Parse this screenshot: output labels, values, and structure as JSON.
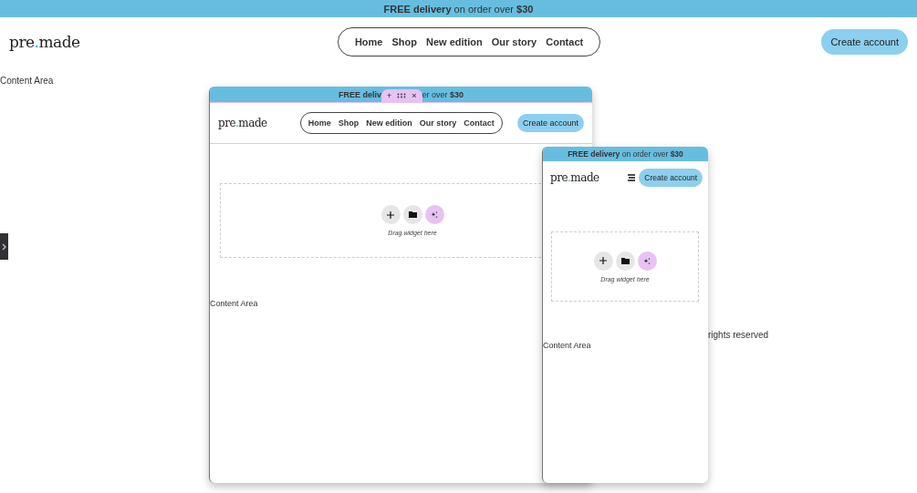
{
  "announcement": {
    "text": "**FREE delivery** on order over **$30**"
  },
  "header": {
    "logo": {
      "before": "pre",
      "dot": ".",
      "after": "made"
    },
    "nav": [
      "Home",
      "Shop",
      "New edition",
      "Our story",
      "Contact"
    ],
    "cta": "Create account"
  },
  "content_label": "Content Area",
  "footer_fragment": "rights reserved",
  "tablet_preview": {
    "banner_before": "**FREE deliv**",
    "banner_after": "er over **$30**",
    "toolbar": {
      "add": "+",
      "close": "×"
    },
    "header_selected": true,
    "logo": {
      "before": "pre",
      "dot": ".",
      "after": "made"
    },
    "nav": [
      "Home",
      "Shop",
      "New edition",
      "Our story",
      "Contact"
    ],
    "cta": "Create account",
    "dropzone_hint": "Drag widget here",
    "content_label": "Content Area"
  },
  "mobile_preview": {
    "banner": "**FREE delivery** on order over **$30**",
    "logo": {
      "before": "pre",
      "dot": ".",
      "after": "made"
    },
    "cta": "Create account",
    "dropzone_hint": "Drag widget here",
    "content_label": "Content Area"
  }
}
